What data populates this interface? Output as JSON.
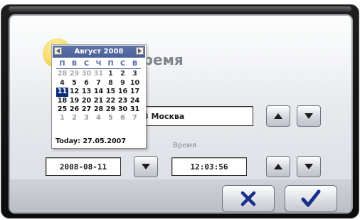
{
  "title": "время",
  "timezone": {
    "value": "3 Москва"
  },
  "date_field": {
    "value": "2008-08-11"
  },
  "time_label": "Время",
  "time_field": {
    "value": "12:03:56"
  },
  "calendar": {
    "month_label": "Август 2008",
    "weekdays": [
      "П",
      "В",
      "С",
      "Ч",
      "П",
      "С",
      "В"
    ],
    "weeks": [
      [
        {
          "d": "28",
          "m": "prev"
        },
        {
          "d": "29",
          "m": "prev"
        },
        {
          "d": "30",
          "m": "prev"
        },
        {
          "d": "31",
          "m": "prev"
        },
        {
          "d": "1"
        },
        {
          "d": "2"
        },
        {
          "d": "3"
        }
      ],
      [
        {
          "d": "4"
        },
        {
          "d": "5"
        },
        {
          "d": "6"
        },
        {
          "d": "7"
        },
        {
          "d": "8"
        },
        {
          "d": "9"
        },
        {
          "d": "10"
        }
      ],
      [
        {
          "d": "11",
          "selected": true
        },
        {
          "d": "12"
        },
        {
          "d": "13"
        },
        {
          "d": "14"
        },
        {
          "d": "15"
        },
        {
          "d": "16"
        },
        {
          "d": "17"
        }
      ],
      [
        {
          "d": "18"
        },
        {
          "d": "19"
        },
        {
          "d": "20"
        },
        {
          "d": "21"
        },
        {
          "d": "22"
        },
        {
          "d": "23"
        },
        {
          "d": "24"
        }
      ],
      [
        {
          "d": "25"
        },
        {
          "d": "26"
        },
        {
          "d": "27"
        },
        {
          "d": "28"
        },
        {
          "d": "29"
        },
        {
          "d": "30"
        },
        {
          "d": "31"
        }
      ],
      [
        {
          "d": "1",
          "m": "next"
        },
        {
          "d": "2",
          "m": "next"
        },
        {
          "d": "3",
          "m": "next"
        },
        {
          "d": "4",
          "m": "next"
        },
        {
          "d": "5",
          "m": "next"
        },
        {
          "d": "6",
          "m": "next"
        },
        {
          "d": "7",
          "m": "next"
        }
      ]
    ],
    "today_label": "Today: 27.05.2007",
    "nav_prev_icon": "triangle-left-icon",
    "nav_next_icon": "triangle-right-icon"
  },
  "icons": {
    "up": "triangle-up-icon",
    "down": "triangle-down-icon",
    "cancel": "x-icon",
    "confirm": "check-icon"
  },
  "colors": {
    "calendar_header": "#0a2a78",
    "cancel_icon": "#1a2f8a",
    "confirm_icon": "#1a2f8a",
    "arrow_icon": "#1c1c1c"
  }
}
